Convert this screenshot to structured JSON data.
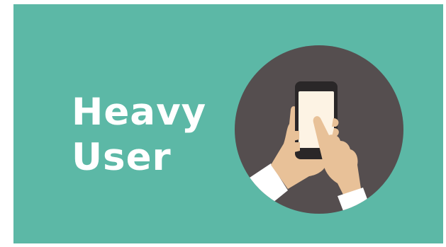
{
  "slide": {
    "background_color": "#5cb8a6",
    "title_lines": [
      "Heavy",
      "User"
    ],
    "title_color": "#ffffff"
  },
  "illustration": {
    "icon": "hands-holding-smartphone-icon",
    "circle_color": "#554e4f",
    "phone_screen_color": "#fdf3e4",
    "skin_color": "#e8c198",
    "sleeve_color": "#ffffff"
  }
}
